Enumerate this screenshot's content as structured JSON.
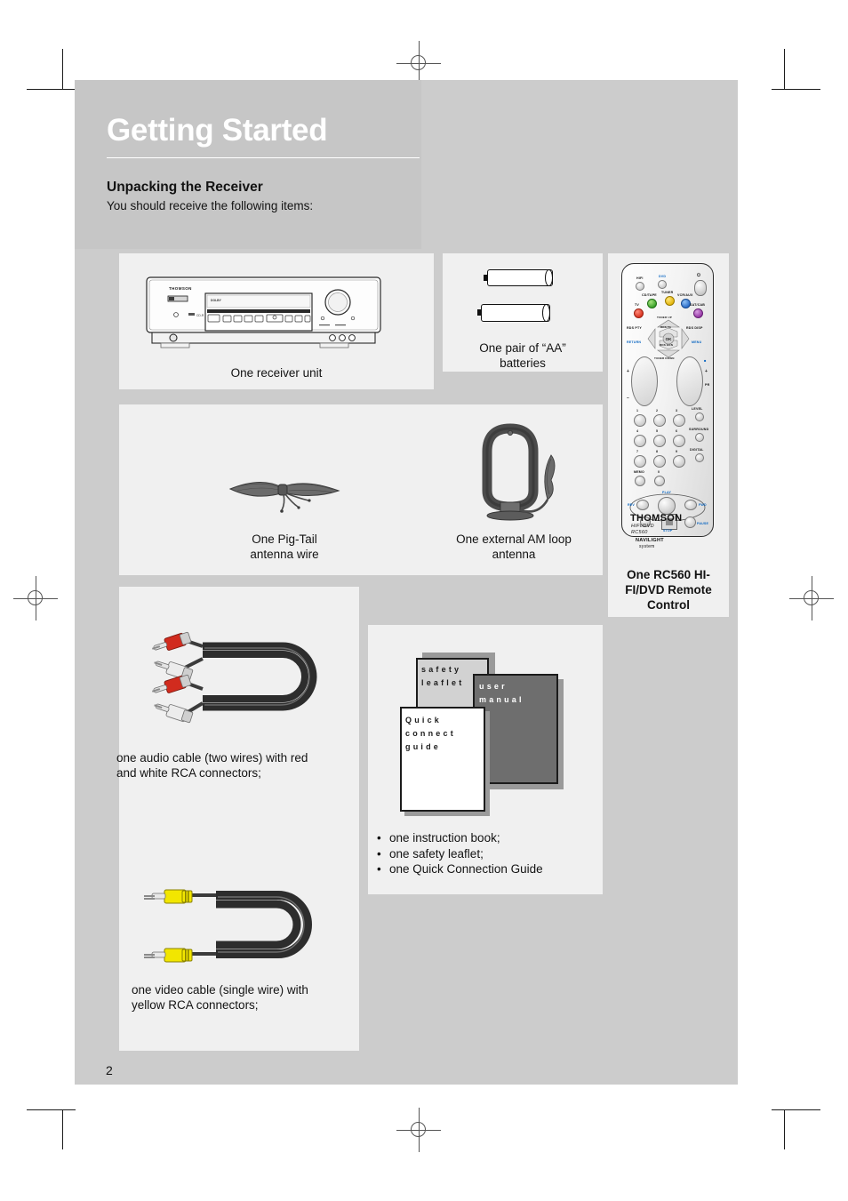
{
  "page": {
    "title": "Getting Started",
    "section_heading": "Unpacking the Receiver",
    "section_subtext": "You should receive the following items:",
    "page_number": "2"
  },
  "items": {
    "receiver": {
      "caption": "One receiver unit",
      "brand_label": "THOMSON",
      "display_label": "DOLBY"
    },
    "batteries": {
      "caption_line1": "One pair of “AA”",
      "caption_line2": "batteries",
      "count": 2
    },
    "pigtail": {
      "caption_line1": "One Pig-Tail",
      "caption_line2": "antenna wire"
    },
    "am_loop": {
      "caption_line1": "One external AM loop",
      "caption_line2": "antenna"
    },
    "remote": {
      "caption_line1": "One RC560 HI-",
      "caption_line2": "FI/DVD Remote",
      "caption_line3": "Control",
      "brand": "THOMSON",
      "model_line1": "HIFI/DVD",
      "model_line2": "RC560",
      "system_line1": "NAVILIGHT",
      "system_line2": "system",
      "source_buttons": [
        {
          "label": "HIFI",
          "color": "grey"
        },
        {
          "label": "DVD",
          "color": "grey"
        },
        {
          "label": "CD/TAPE",
          "color": "green"
        },
        {
          "label": "TUNER",
          "color": "yellow"
        },
        {
          "label": "VCR/AUX",
          "color": "blue"
        },
        {
          "label": "TV",
          "color": "red"
        },
        {
          "label": "SAT/CAB",
          "color": "purple"
        }
      ],
      "nav_labels": {
        "up": "TUNER UP",
        "down": "TUNER DOWN",
        "center": "OK",
        "upper_center": "RDS TA",
        "lower_center": "RDS EON",
        "left": "RDS PTY",
        "left_sub": "RETURN",
        "right": "RDS DISP",
        "right_sub": "MENU"
      },
      "keypad": [
        "1",
        "2",
        "3",
        "4",
        "5",
        "6",
        "7",
        "8",
        "9"
      ],
      "side_labels": [
        "LEVEL",
        "SURROUND",
        "DIGITAL"
      ],
      "memo_label": "MEMO",
      "zero_label": "0",
      "transport": {
        "play": "PLAY",
        "rev": "REV",
        "fwd": "FWD",
        "stop": "STOP",
        "pause": "PAUSE"
      },
      "power_icon": "power-icon",
      "volume_label": "+",
      "pr_label": "PR"
    },
    "audio_cable": {
      "caption_line1": "one audio cable (two wires) with red",
      "caption_line2": "and white RCA connectors;",
      "connector_colors": [
        "#d12b1e",
        "#e8e8e8",
        "#d12b1e",
        "#e8e8e8"
      ]
    },
    "video_cable": {
      "caption_line1": "one video cable (single wire) with",
      "caption_line2": "yellow RCA connectors;",
      "connector_color": "#f2e600"
    },
    "manuals": {
      "safety_leaflet": "safety\nleaflet",
      "safety_line1": "safety",
      "safety_line2": "leaflet",
      "user_manual_line1": "user",
      "user_manual_line2": "manual",
      "quick_line1": "Quick",
      "quick_line2": "connect",
      "quick_line3": "guide",
      "bullets": [
        "one instruction book;",
        "one safety leaflet;",
        "one Quick Connection Guide"
      ]
    }
  },
  "colors": {
    "page_bg": "#cccccc",
    "panel_bg": "#f0f0f0",
    "header_band": "#c6c6c6",
    "title_color": "#ffffff",
    "text_color": "#131313"
  }
}
